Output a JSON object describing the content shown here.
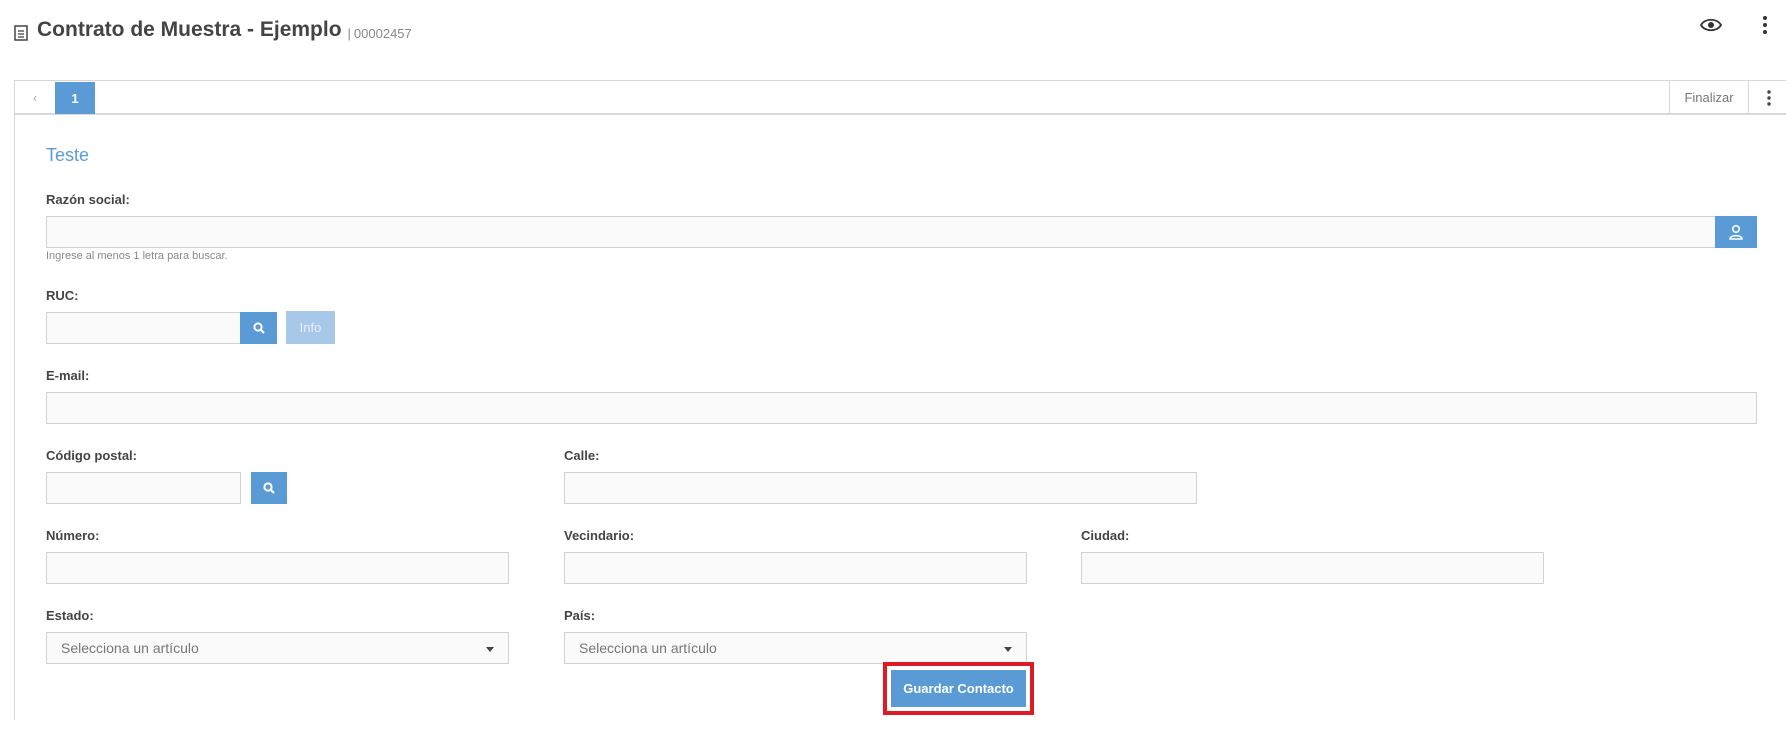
{
  "header": {
    "title": "Contrato de Muestra - Ejemplo",
    "separator": "|",
    "doc_number": "00002457"
  },
  "icons": {
    "document": "document-icon",
    "view": "eye-icon",
    "more": "vertical-dots-icon",
    "prev": "chevron-left-icon",
    "user": "user-icon",
    "search": "search-icon",
    "dropdown": "caret-down-icon"
  },
  "tabs": {
    "prev_label": "‹",
    "current_page": "1",
    "finish_label": "Finalizar"
  },
  "form": {
    "section_title": "Teste",
    "razon_social": {
      "label": "Razón social:",
      "value": "",
      "hint": "Ingrese al menos 1 letra para buscar."
    },
    "ruc": {
      "label": "RUC:",
      "value": "",
      "info_label": "Info"
    },
    "email": {
      "label": "E-mail:",
      "value": ""
    },
    "codigo_postal": {
      "label": "Código postal:",
      "value": ""
    },
    "calle": {
      "label": "Calle:",
      "value": ""
    },
    "numero": {
      "label": "Número:",
      "value": ""
    },
    "vecindario": {
      "label": "Vecindario:",
      "value": ""
    },
    "ciudad": {
      "label": "Ciudad:",
      "value": ""
    },
    "estado": {
      "label": "Estado:",
      "placeholder": "Selecciona un artículo"
    },
    "pais": {
      "label": "País:",
      "placeholder": "Selecciona un artículo"
    },
    "save_label": "Guardar Contacto"
  },
  "colors": {
    "accent": "#5b9bd5",
    "highlight": "#dd1b24",
    "info_disabled": "#a8c8ea"
  }
}
